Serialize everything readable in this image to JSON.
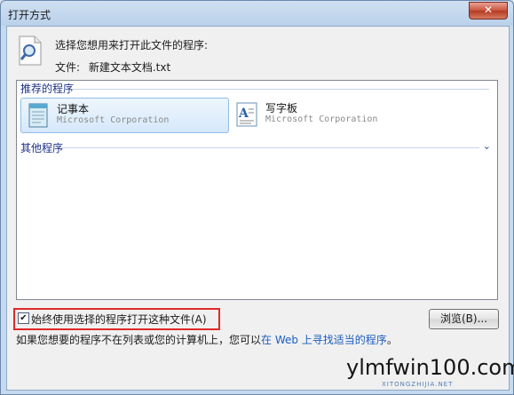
{
  "window": {
    "title": "打开方式",
    "close_label": "✕"
  },
  "header": {
    "prompt": "选择您想用来打开此文件的程序:",
    "file_label": "文件:",
    "file_name": "新建文本文档.txt"
  },
  "programs": {
    "recommended_title": "推荐的程序",
    "other_title": "其他程序",
    "items": [
      {
        "name": "记事本",
        "company": "Microsoft Corporation",
        "selected": true
      },
      {
        "name": "写字板",
        "company": "Microsoft Corporation",
        "selected": false
      }
    ]
  },
  "options": {
    "always_use_label": "始终使用选择的程序打开这种文件(A)",
    "always_use_checked": true,
    "browse_label": "浏览(B)..."
  },
  "footer": {
    "text_before": "如果您想要的程序不在列表或您的计算机上，您可以",
    "link_text": "在 Web 上寻找适当的程序",
    "text_after": "。"
  },
  "watermark": {
    "main": "ylmfwin100.com",
    "sub": "XITONGZHIJIA.NET"
  },
  "colors": {
    "link": "#1c5dbf",
    "group_title": "#1e3287",
    "highlight_border": "#e02929"
  }
}
